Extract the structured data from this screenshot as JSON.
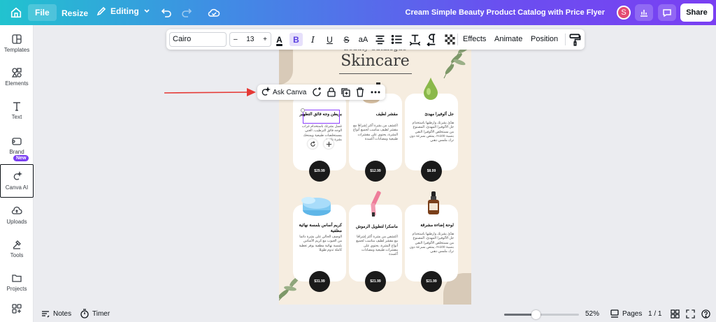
{
  "topbar": {
    "file_label": "File",
    "resize_label": "Resize",
    "editing_label": "Editing",
    "document_title": "Cream Simple Beauty Product Catalog with Price Flyer",
    "avatar_initial": "S",
    "share_label": "Share"
  },
  "sidebar": {
    "items": [
      {
        "label": "Templates",
        "icon": "templates-icon"
      },
      {
        "label": "Elements",
        "icon": "elements-icon"
      },
      {
        "label": "Text",
        "icon": "text-icon"
      },
      {
        "label": "Brand",
        "icon": "brand-icon"
      },
      {
        "label": "Canva AI",
        "icon": "canva-ai-icon"
      },
      {
        "label": "Uploads",
        "icon": "uploads-icon"
      },
      {
        "label": "Tools",
        "icon": "tools-icon"
      },
      {
        "label": "Projects",
        "icon": "projects-icon"
      }
    ],
    "new_badge": "New"
  },
  "format_toolbar": {
    "font_name": "Cairo",
    "font_size": "13",
    "minus": "–",
    "plus": "+",
    "aa_label": "aA",
    "effects_label": "Effects",
    "animate_label": "Animate",
    "position_label": "Position"
  },
  "ask_toolbar": {
    "label": "Ask Canva"
  },
  "catalog": {
    "subtitle": "Beauty Catalogue",
    "title": "Skincare",
    "products": [
      {
        "name": "بريطن وجه فائق التطهير",
        "desc": "غسل بشرتك باستخدام غراب الوجه فائق الترطيب، الغني بمستخلصات طبيعية ويمنحك بشرة ناعمة",
        "price": "$29.99",
        "icon": "face-cream-jar"
      },
      {
        "name": "مقشر لطيف",
        "desc": "اكتشف من بشرة أكثر إشراقا مع مقشر لطيف مناسب لجميع أنواع البشرة، يحتوي على مقشرات طبيعية ومضادات أكسدة",
        "price": "$12.99",
        "icon": "serum-bottle"
      },
      {
        "name": "جل ألوفيرا مهدئ",
        "desc": "هدّئ بشرتك وارطبها باستخدام جل الألوفيرا المهدئ، المصنوع من مستخلص الألوفيرا النقي بنسبة 100%، يمتص بسرعة دون ترك ملمس دهني",
        "price": "$8.99",
        "icon": "green-drop"
      },
      {
        "name": "كريم أساس بلمسة نهائية مطفية",
        "desc": "الوصف الحالي على بشرة دائما من العيوب مع كريم الأساس بلمسة نهائية مطفية يوفر تغطية كاملة تدوم طويلا",
        "price": "$31.99",
        "icon": "blue-cream-jar"
      },
      {
        "name": "ماسكرا لتطويل الرموش",
        "desc": "اكتشفي من بشرة أكثر إشراقا مع مقشر لطيف مناسب لجميع أنواع البشرة، يحتوي على مقشرات طبيعية ومضادات أكسدة",
        "price": "$21.99",
        "icon": "mascara"
      },
      {
        "name": "لوحة إضاءة مشرقة",
        "desc": "هدّئ بشرتك وارطبها باستخدام جل الألوفيرا المهدئ، المصنوع من مستخلص الألوفيرا النقي بنسبة 100%، يمتص بسرعة دون ترك ملمس دهني",
        "price": "$21.99",
        "icon": "dropper-bottle"
      }
    ]
  },
  "bottombar": {
    "notes_label": "Notes",
    "timer_label": "Timer",
    "zoom_fraction": 0.42,
    "zoom_label": "52%",
    "pages_label": "Pages",
    "page_counter": "1 / 1"
  },
  "colors": {
    "accent_purple": "#7b3ff2",
    "selection": "#8b3dff",
    "page_bg": "#f6ede0",
    "annotation_arrow": "#e53935"
  }
}
